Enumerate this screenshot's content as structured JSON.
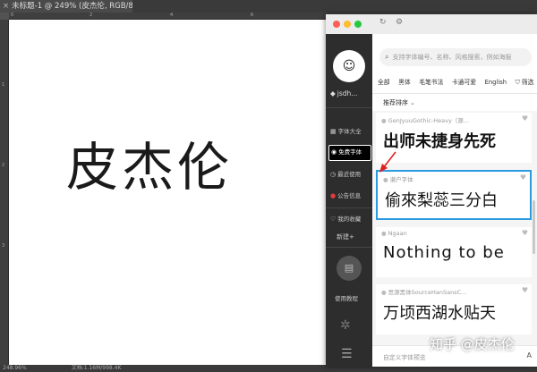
{
  "photoshop": {
    "tab_title": "未标题-1 @ 249% (皮杰伦, RGB/8) *",
    "tab_close": "×",
    "ruler_top_numbers": [
      "0",
      "2",
      "4",
      "6"
    ],
    "ruler_left_numbers": [
      "1",
      "2",
      "3"
    ],
    "canvas_text": "皮杰伦",
    "status_zoom": "248.96%",
    "status_doc": "文档:1.16M/998.4K"
  },
  "app": {
    "colors": {
      "sidebar": "#2d2d2d",
      "accent": "#2d9ae0",
      "hot": "#e23c3c"
    },
    "sidebar": {
      "username": "jsdh...",
      "items": [
        {
          "label": "字体大全",
          "icon": "grid-icon",
          "glyph": "▦"
        },
        {
          "label": "免费字体",
          "icon": "free-icon",
          "glyph": "◉"
        },
        {
          "label": "最近使用",
          "icon": "clock-icon",
          "glyph": "◷"
        },
        {
          "label": "公告信息",
          "icon": "notice-icon",
          "glyph": "●"
        },
        {
          "label": "我的收藏",
          "icon": "heart-icon",
          "glyph": "♡"
        }
      ],
      "new_label": "新建+",
      "tutorial_label": "使用教程"
    },
    "search_placeholder": "支持字体编号、名称、风格搜索，例如海报",
    "categories": [
      "全部",
      "黑体",
      "毛笔书法",
      "卡通可爱",
      "English",
      "筛选"
    ],
    "sort_label": "推荐排序",
    "fonts": [
      {
        "name": "GenJyuuGothic-Heavy（源...",
        "preview": "出师未捷身先死"
      },
      {
        "name": "濑户字体",
        "preview": "偷來梨蕊三分白"
      },
      {
        "name": "Ngaan",
        "preview": "Nothing to be"
      },
      {
        "name": "思源黑体SourceHanSansC...",
        "preview": "万顷西湖水贴天"
      }
    ],
    "custom_preview_label": "自定义字体预览",
    "custom_icon": "A"
  },
  "watermark": "知乎 @皮杰伦"
}
